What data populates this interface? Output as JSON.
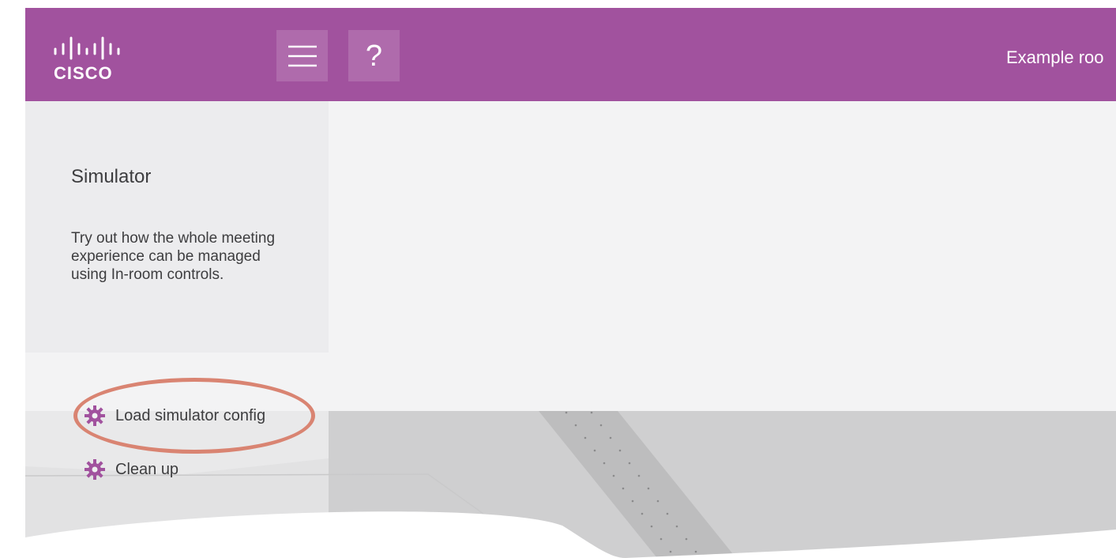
{
  "header": {
    "logo_text": "CISCO",
    "room_name": "Example roo",
    "menu_icon": "hamburger-menu-icon",
    "help_label": "?",
    "brand_color": "#a1529e"
  },
  "sidebar": {
    "title": "Simulator",
    "description": "Try out how the whole meeting experience can be managed using In-room controls."
  },
  "actions": {
    "load_label": "Load simulator config",
    "clean_label": "Clean up",
    "icon": "gear-icon",
    "icon_color": "#a1529e"
  },
  "annotation": {
    "highlight_color": "#d98472"
  }
}
